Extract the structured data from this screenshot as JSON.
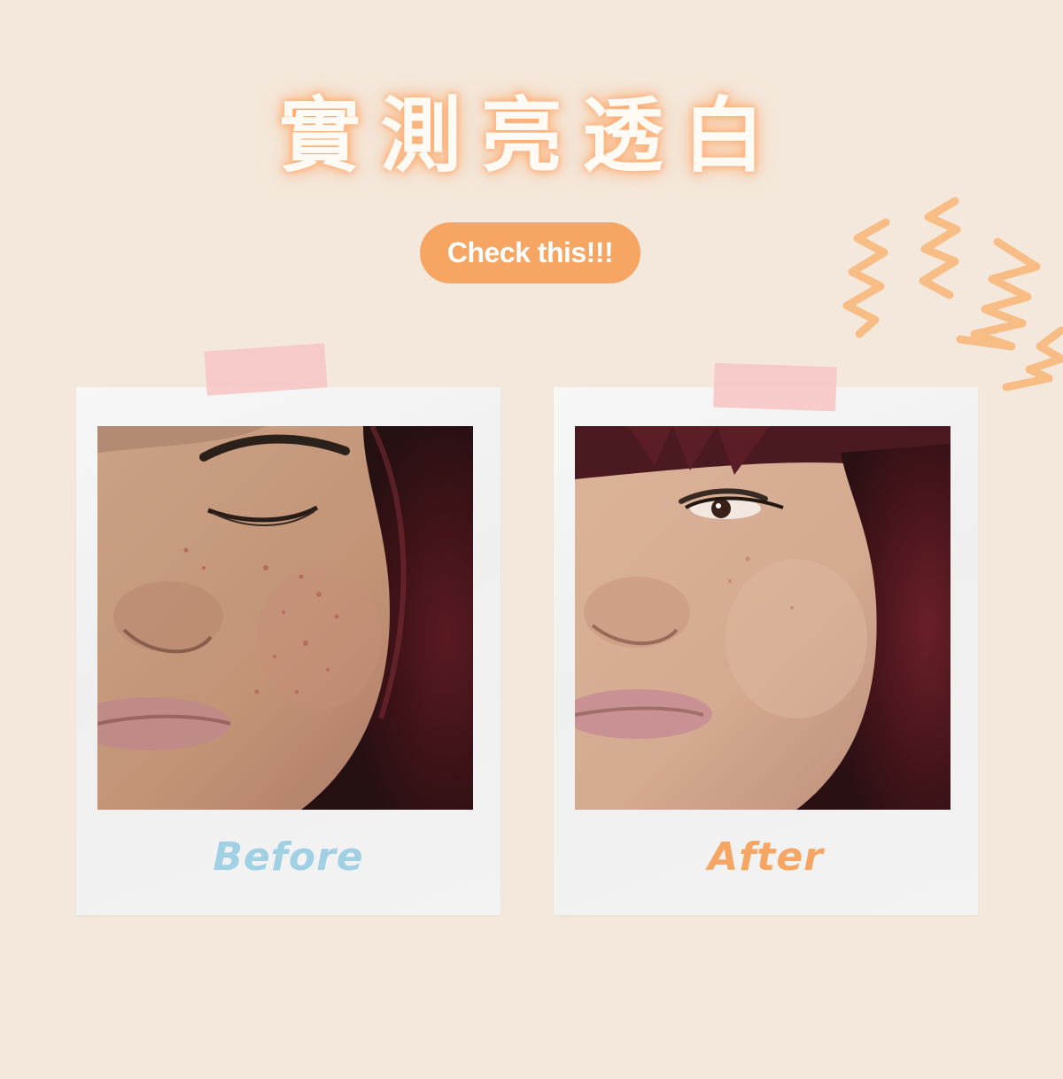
{
  "header": {
    "title": "實測亮透白",
    "cta_label": "Check this!!!"
  },
  "comparison": {
    "before": {
      "caption": "Before",
      "caption_color": "#9fd0e3"
    },
    "after": {
      "caption": "After",
      "caption_color": "#f6a562"
    }
  },
  "colors": {
    "background": "#f4e8dc",
    "accent": "#f6a562",
    "tape": "#f6c8c6"
  },
  "icons": [
    "zigzag-squiggle-icon"
  ]
}
